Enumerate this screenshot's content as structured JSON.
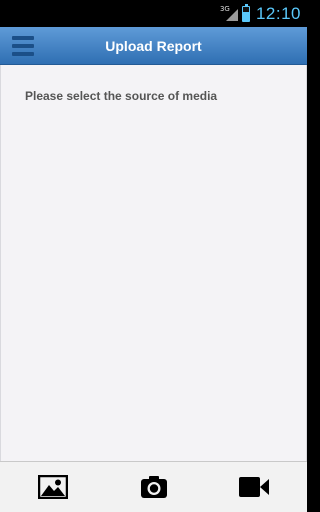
{
  "status_bar": {
    "network_label": "3G",
    "time": "12:10",
    "accent_color": "#5ac8fa"
  },
  "app_bar": {
    "title": "Upload Report",
    "menu_icon": "hamburger-menu-icon",
    "colors": {
      "gradient_top": "#5f9bd8",
      "gradient_bottom": "#2f6fb3"
    }
  },
  "content": {
    "prompt": "Please select the source of media"
  },
  "bottom_bar": {
    "actions": [
      {
        "icon": "gallery-image-icon"
      },
      {
        "icon": "camera-icon"
      },
      {
        "icon": "video-camera-icon"
      }
    ]
  }
}
